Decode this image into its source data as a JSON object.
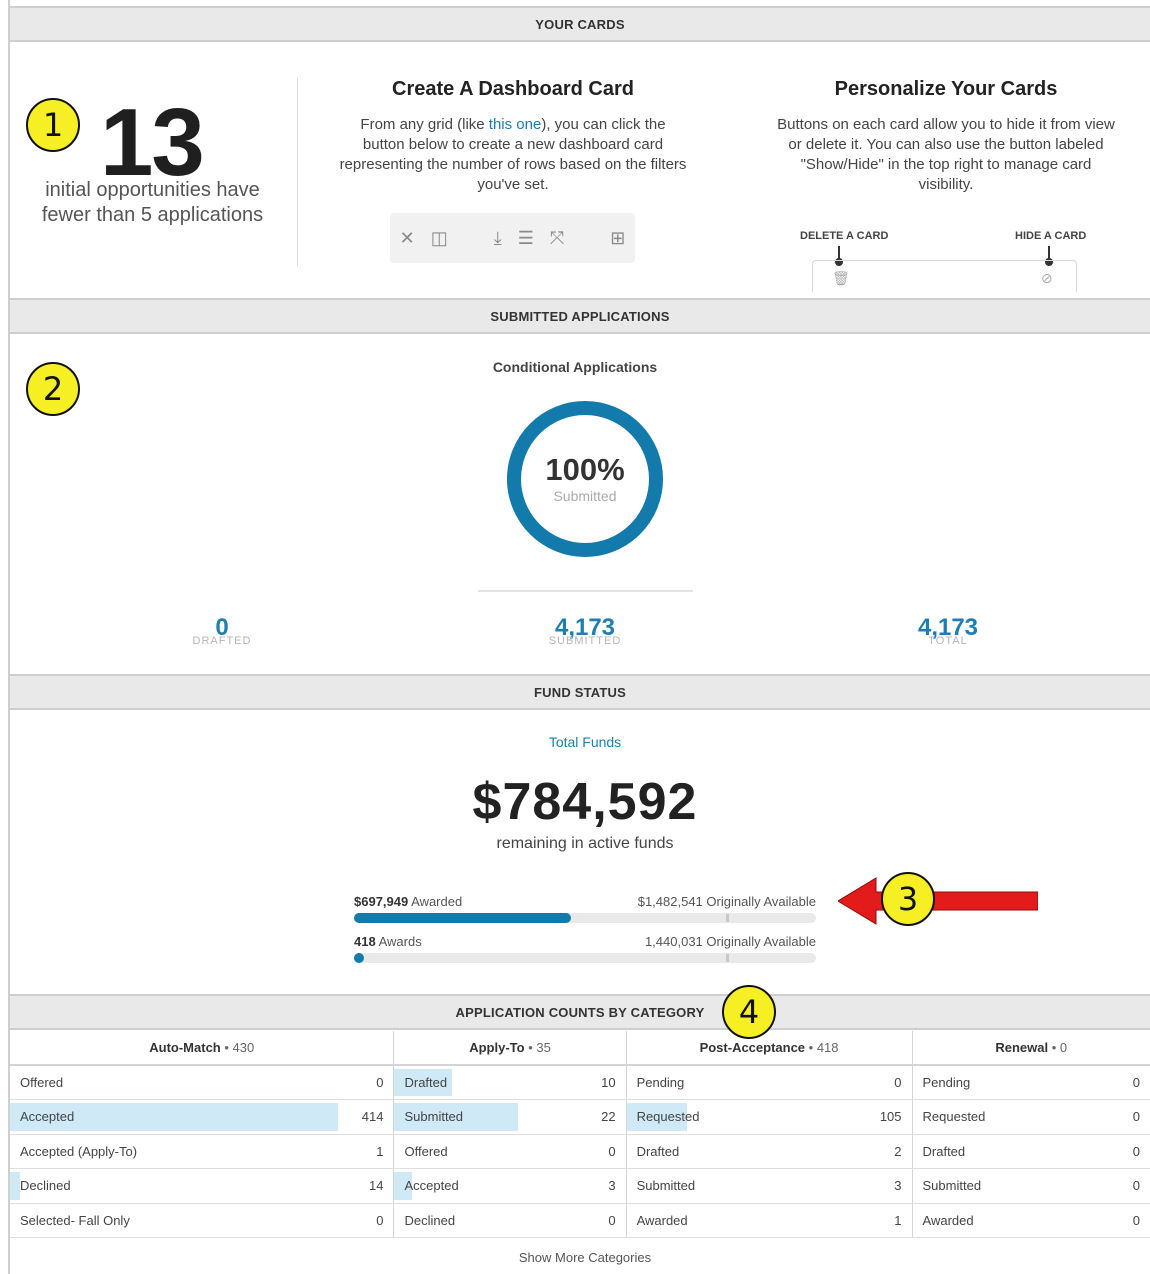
{
  "sections": {
    "your_cards": "YOUR CARDS",
    "submitted_applications": "SUBMITTED APPLICATIONS",
    "fund_status": "FUND STATUS",
    "application_counts": "APPLICATION COUNTS BY CATEGORY"
  },
  "badges": [
    "1",
    "2",
    "3",
    "4"
  ],
  "opportunity_card": {
    "number": "13",
    "caption": "initial opportunities have fewer than 5 applications"
  },
  "create_card": {
    "title": "Create A Dashboard Card",
    "text_before": "From any grid (like ",
    "link": "this one",
    "text_after": "), you can click the button below to create a new dashboard card representing the number of rows based on the filters you've set.",
    "toolbar_icons": [
      "close-icon",
      "columns-icon",
      "download-icon",
      "list-icon",
      "expand-icon",
      "dashboard-card-icon"
    ]
  },
  "personalize_card": {
    "title": "Personalize Your Cards",
    "text": "Buttons on each card allow you to hide it from view or delete it. You can also use the button labeled \"Show/Hide\" in the top right to manage card visibility.",
    "delete_label": "DELETE A CARD",
    "hide_label": "HIDE A CARD"
  },
  "conditional_applications": {
    "title": "Conditional Applications",
    "percent": "100%",
    "percent_value": 100,
    "percent_label": "Submitted",
    "stats": [
      {
        "value": "0",
        "label": "DRAFTED"
      },
      {
        "value": "4,173",
        "label": "SUBMITTED"
      },
      {
        "value": "4,173",
        "label": "TOTAL"
      }
    ],
    "accent": "#127bab"
  },
  "fund_status": {
    "label": "Total Funds",
    "value": "$784,592",
    "caption": "remaining in active funds",
    "bars": [
      {
        "left_bold": "$697,949",
        "left_text": " Awarded",
        "right": "$1,482,541 Originally Available",
        "fill": 0.47
      },
      {
        "left_bold": "418",
        "left_text": " Awards",
        "right": "1,440,031 Originally Available",
        "fill": 0.0
      }
    ]
  },
  "categories": [
    {
      "name": "Auto-Match",
      "count": " • 430",
      "rows": [
        {
          "label": "Offered",
          "value": "0",
          "pct": 0
        },
        {
          "label": "Accepted",
          "value": "414",
          "pct": 0.96
        },
        {
          "label": "Accepted (Apply-To)",
          "value": "1",
          "pct": 0
        },
        {
          "label": "Declined",
          "value": "14",
          "pct": 0.03
        },
        {
          "label": "Selected- Fall Only",
          "value": "0",
          "pct": 0
        }
      ]
    },
    {
      "name": "Apply-To",
      "count": " • 35",
      "rows": [
        {
          "label": "Drafted",
          "value": "10",
          "pct": 0.29
        },
        {
          "label": "Submitted",
          "value": "22",
          "pct": 0.63
        },
        {
          "label": "Offered",
          "value": "0",
          "pct": 0
        },
        {
          "label": "Accepted",
          "value": "3",
          "pct": 0.09
        },
        {
          "label": "Declined",
          "value": "0",
          "pct": 0
        }
      ]
    },
    {
      "name": "Post-Acceptance",
      "count": " • 418",
      "rows": [
        {
          "label": "Pending",
          "value": "0",
          "pct": 0
        },
        {
          "label": "Requested",
          "value": "105",
          "pct": 0.25
        },
        {
          "label": "Drafted",
          "value": "2",
          "pct": 0
        },
        {
          "label": "Submitted",
          "value": "3",
          "pct": 0
        },
        {
          "label": "Awarded",
          "value": "1",
          "pct": 0
        }
      ]
    },
    {
      "name": "Renewal",
      "count": " • 0",
      "rows": [
        {
          "label": "Pending",
          "value": "0",
          "pct": 0
        },
        {
          "label": "Requested",
          "value": "0",
          "pct": 0
        },
        {
          "label": "Drafted",
          "value": "0",
          "pct": 0
        },
        {
          "label": "Submitted",
          "value": "0",
          "pct": 0
        },
        {
          "label": "Awarded",
          "value": "0",
          "pct": 0
        }
      ]
    }
  ],
  "show_more": "Show More Categories"
}
